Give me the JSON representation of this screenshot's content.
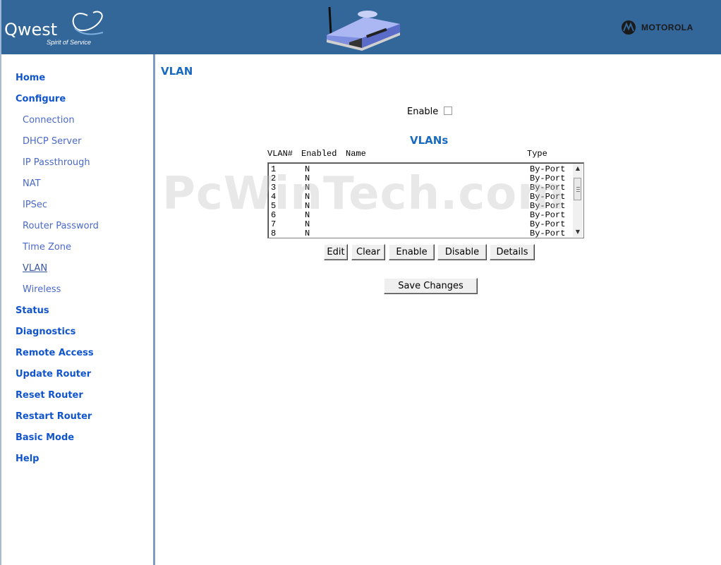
{
  "header": {
    "brand_name": "Qwest",
    "brand_tagline": "Spirit of Service",
    "vendor_name": "MOTOROLA"
  },
  "sidebar": {
    "items": [
      {
        "label": "Home",
        "level": "main"
      },
      {
        "label": "Configure",
        "level": "main"
      },
      {
        "label": "Connection",
        "level": "sub"
      },
      {
        "label": "DHCP Server",
        "level": "sub"
      },
      {
        "label": "IP Passthrough",
        "level": "sub"
      },
      {
        "label": "NAT",
        "level": "sub"
      },
      {
        "label": "IPSec",
        "level": "sub"
      },
      {
        "label": "Router Password",
        "level": "sub"
      },
      {
        "label": "Time Zone",
        "level": "sub"
      },
      {
        "label": "VLAN",
        "level": "sub",
        "active": true
      },
      {
        "label": "Wireless",
        "level": "sub"
      },
      {
        "label": "Status",
        "level": "main"
      },
      {
        "label": "Diagnostics",
        "level": "main"
      },
      {
        "label": "Remote Access",
        "level": "main"
      },
      {
        "label": "Update Router",
        "level": "main"
      },
      {
        "label": "Reset Router",
        "level": "main"
      },
      {
        "label": "Restart Router",
        "level": "main"
      },
      {
        "label": "Basic Mode",
        "level": "main"
      },
      {
        "label": "Help",
        "level": "main"
      }
    ]
  },
  "main": {
    "title": "VLAN",
    "enable_label": "Enable",
    "enable_checked": false,
    "vlans_title": "VLANs",
    "columns": [
      "VLAN#",
      "Enabled",
      "Name",
      "Type"
    ],
    "rows": [
      {
        "num": "1",
        "enabled": "N",
        "name": "",
        "type": "By-Port"
      },
      {
        "num": "2",
        "enabled": "N",
        "name": "",
        "type": "By-Port"
      },
      {
        "num": "3",
        "enabled": "N",
        "name": "",
        "type": "By-Port"
      },
      {
        "num": "4",
        "enabled": "N",
        "name": "",
        "type": "By-Port"
      },
      {
        "num": "5",
        "enabled": "N",
        "name": "",
        "type": "By-Port"
      },
      {
        "num": "6",
        "enabled": "N",
        "name": "",
        "type": "By-Port"
      },
      {
        "num": "7",
        "enabled": "N",
        "name": "",
        "type": "By-Port"
      },
      {
        "num": "8",
        "enabled": "N",
        "name": "",
        "type": "By-Port"
      }
    ],
    "buttons": {
      "edit": "Edit",
      "clear": "Clear",
      "enable": "Enable",
      "disable": "Disable",
      "details": "Details",
      "save": "Save Changes"
    },
    "watermark": "PcWinTech.com"
  },
  "colors": {
    "header_bg": "#336699",
    "nav_main": "#1155cc",
    "nav_sub": "#4a69c8",
    "title": "#1a6ac0"
  }
}
